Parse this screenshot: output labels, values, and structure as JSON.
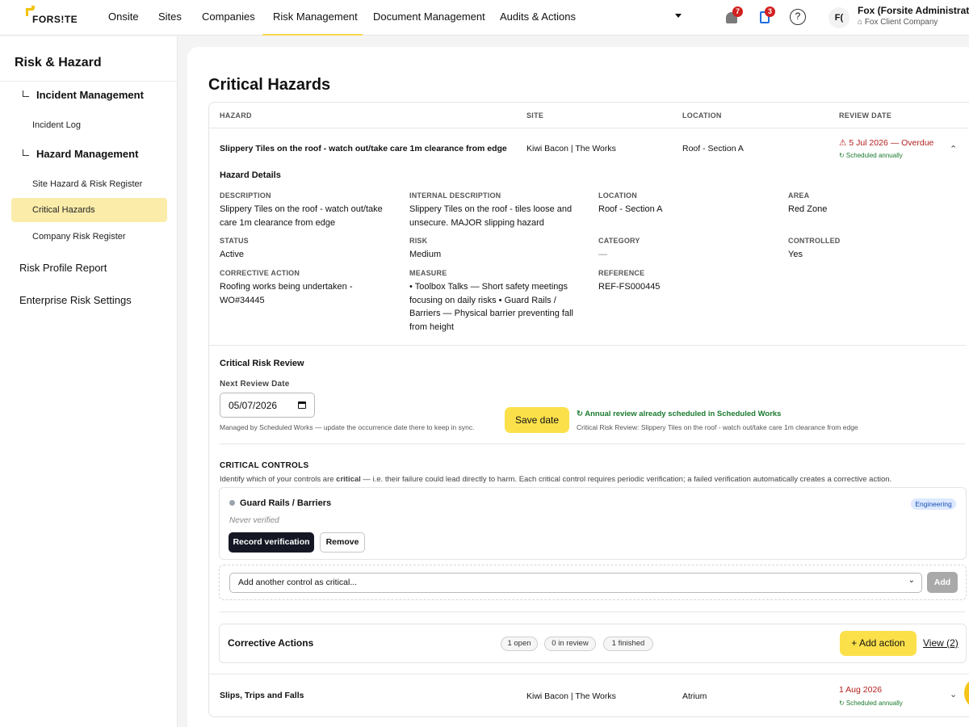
{
  "nav": {
    "logo": "FORS!TE",
    "items": [
      "Onsite",
      "Sites",
      "Companies",
      "Risk Management",
      "Document Management",
      "Audits & Actions"
    ],
    "active": "Risk Management",
    "notifications_count": "7",
    "clipboard_count": "3",
    "help": "?",
    "avatar_initials": "F(",
    "user_name": "Fox (Forsite Administrator)",
    "user_company": "Fox Client Company"
  },
  "sidebar": {
    "title": "Risk & Hazard",
    "groups": [
      {
        "label": "Incident Management",
        "items": [
          "Incident Log"
        ]
      },
      {
        "label": "Hazard Management",
        "items": [
          "Site Hazard & Risk Register",
          "Critical Hazards",
          "Company Risk Register"
        ]
      }
    ],
    "active_item": "Critical Hazards",
    "top_items": [
      "Risk Profile Report",
      "Enterprise Risk Settings"
    ]
  },
  "page": {
    "title": "Critical Hazards",
    "columns": [
      "HAZARD",
      "SITE",
      "LOCATION",
      "REVIEW DATE"
    ]
  },
  "rows": [
    {
      "hazard": "Slippery Tiles on the roof - watch out/take care 1m clearance from edge",
      "site": "Kiwi Bacon | The Works",
      "location": "Roof - Section A",
      "review_date": "⚠ 5 Jul 2026 — Overdue",
      "schedule": "↻ Scheduled annually",
      "expanded": true
    },
    {
      "hazard": "Slips, Trips and Falls",
      "site": "Kiwi Bacon | The Works",
      "location": "Atrium",
      "review_date": "1 Aug 2026",
      "schedule": "↻ Scheduled annually",
      "expanded": false
    }
  ],
  "details": {
    "title": "Hazard Details",
    "description_label": "DESCRIPTION",
    "description_lines": [
      "Slippery Tiles on the roof - watch out/take",
      "care 1m clearance from edge"
    ],
    "internal_label": "INTERNAL DESCRIPTION",
    "internal_lines": [
      "Slippery Tiles on the roof - tiles loose and",
      "unsecure. MAJOR slipping hazard"
    ],
    "location_label": "LOCATION",
    "location": "Roof - Section A",
    "area_label": "AREA",
    "area": "Red Zone",
    "status_label": "STATUS",
    "status": "Active",
    "risk_label": "RISK",
    "risk": "Medium",
    "category_label": "CATEGORY",
    "category": "—",
    "controlled_label": "CONTROLLED",
    "controlled": "Yes",
    "corrective_label": "CORRECTIVE ACTION",
    "corrective_lines": [
      "Roofing works being undertaken -",
      "WO#34445"
    ],
    "measure_label": "MEASURE",
    "measure_lines": [
      "• Toolbox Talks — Short safety meetings",
      "focusing on daily risks • Guard Rails /",
      "Barriers — Physical barrier preventing fall",
      "from height"
    ],
    "reference_label": "REFERENCE",
    "reference": "REF-FS000445"
  },
  "review": {
    "title": "Critical Risk Review",
    "next_label": "Next Review Date",
    "date_value": "05/07/2026",
    "helper": "Managed by Scheduled Works — update the occurrence date there to keep in sync.",
    "save_label": "Save date",
    "annual": "↻ Annual review already scheduled in Scheduled Works",
    "annual_sub": "Critical Risk Review: Slippery Tiles on the roof - watch out/take care 1m clearance from edge"
  },
  "controls": {
    "title": "CRITICAL CONTROLS",
    "desc_pre": "Identify which of your controls are ",
    "desc_bold": "critical",
    "desc_post": " — i.e. their failure could lead directly to harm. Each critical control requires periodic verification; a failed verification automatically creates a corrective action.",
    "control_name": "Guard Rails / Barriers",
    "control_type": "Engineering",
    "verified_status": "Never verified",
    "record_label": "Record verification",
    "remove_label": "Remove",
    "select_placeholder": "Add another control as critical...",
    "add_label": "Add"
  },
  "corrective": {
    "title": "Corrective Actions",
    "open": "1 open",
    "review": "0 in review",
    "finished": "1 finished",
    "add_label": "+ Add action",
    "view_label": "View (2)"
  },
  "colors": {
    "accent": "#fbe04a",
    "overdue": "#b22020",
    "scheduled": "#1a7a2e",
    "active_sidebar": "#fbecaa"
  }
}
